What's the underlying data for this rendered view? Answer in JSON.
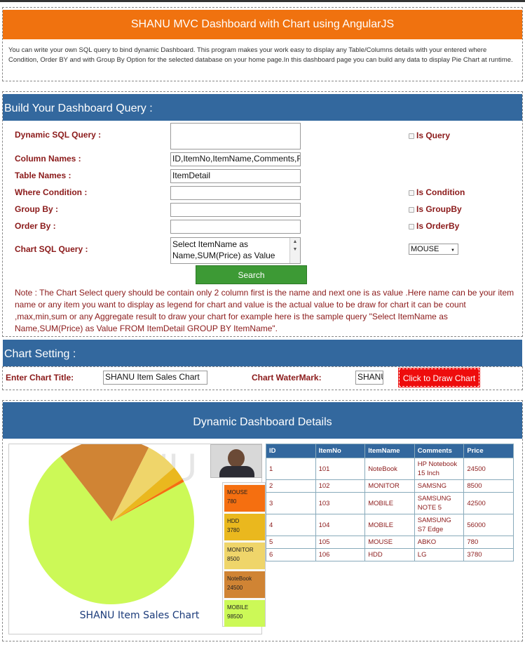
{
  "header": {
    "title": "SHANU MVC Dashboard with Chart using AngularJS",
    "intro": "You can write your own SQL query to bind dynamic Dashboard. This program makes your work easy to display any Table/Columns details with your entered where Condition, Order BY and with Group By Option for the selected database on your home page.In this dashboard page you can build any data to display Pie Chart at runtime."
  },
  "query": {
    "heading": "Build Your Dashboard Query :",
    "dynamic_sql_label": "Dynamic SQL Query :",
    "dynamic_sql_value": "",
    "is_query_label": "Is Query",
    "column_names_label": "Column Names :",
    "column_names_value": "ID,ItemNo,ItemName,Comments,F",
    "table_names_label": "Table Names :",
    "table_names_value": "ItemDetail",
    "where_label": "Where Condition :",
    "where_value": "",
    "is_condition_label": "Is Condition",
    "group_by_label": "Group By :",
    "group_by_value": "",
    "is_groupby_label": "Is GroupBy",
    "order_by_label": "Order By :",
    "order_by_value": "",
    "is_orderby_label": "Is OrderBy",
    "chart_sql_label": "Chart SQL Query :",
    "chart_sql_value": "Select ItemName as Name,SUM(Price) as Value",
    "chart_select_value": "MOUSE",
    "search_label": "Search",
    "note": "Note : The Chart Select query should be contain only 2 column first is the name and next one is as value .Here name can be your item name or any item you want to display as legend for chart and value is the actual value to be draw for chart it can be count ,max,min,sum or any Aggregate result to draw your chart for example here is the sample query \"Select ItemName as Name,SUM(Price) as Value FROM ItemDetail GROUP BY ItemName\"."
  },
  "chart_setting": {
    "heading": "Chart Setting :",
    "title_label": "Enter Chart Title:",
    "title_value": "SHANU Item Sales Chart",
    "watermark_label": "Chart WaterMark:",
    "watermark_value": "SHANU",
    "draw_label": "Click to Draw Chart"
  },
  "details": {
    "heading": "Dynamic Dashboard Details",
    "columns": [
      "ID",
      "ItemNo",
      "ItemName",
      "Comments",
      "Price"
    ],
    "rows": [
      [
        "1",
        "101",
        "NoteBook",
        "HP Notebook 15 Inch",
        "24500"
      ],
      [
        "2",
        "102",
        "MONITOR",
        "SAMSNG",
        "8500"
      ],
      [
        "3",
        "103",
        "MOBILE",
        "SAMSUNG NOTE 5",
        "42500"
      ],
      [
        "4",
        "104",
        "MOBILE",
        "SAMSUNG S7 Edge",
        "56000"
      ],
      [
        "5",
        "105",
        "MOUSE",
        "ABKO",
        "780"
      ],
      [
        "6",
        "106",
        "HDD",
        "LG",
        "3780"
      ]
    ]
  },
  "chart_data": {
    "type": "pie",
    "title": "SHANU Item Sales Chart",
    "watermark": "SHANU",
    "categories": [
      "MOUSE",
      "HDD",
      "MONITOR",
      "NoteBook",
      "MOBILE"
    ],
    "values": [
      780,
      3780,
      8500,
      24500,
      98500
    ],
    "colors": [
      "#f56f10",
      "#eab81e",
      "#efd56a",
      "#d08434",
      "#ccf957"
    ]
  }
}
